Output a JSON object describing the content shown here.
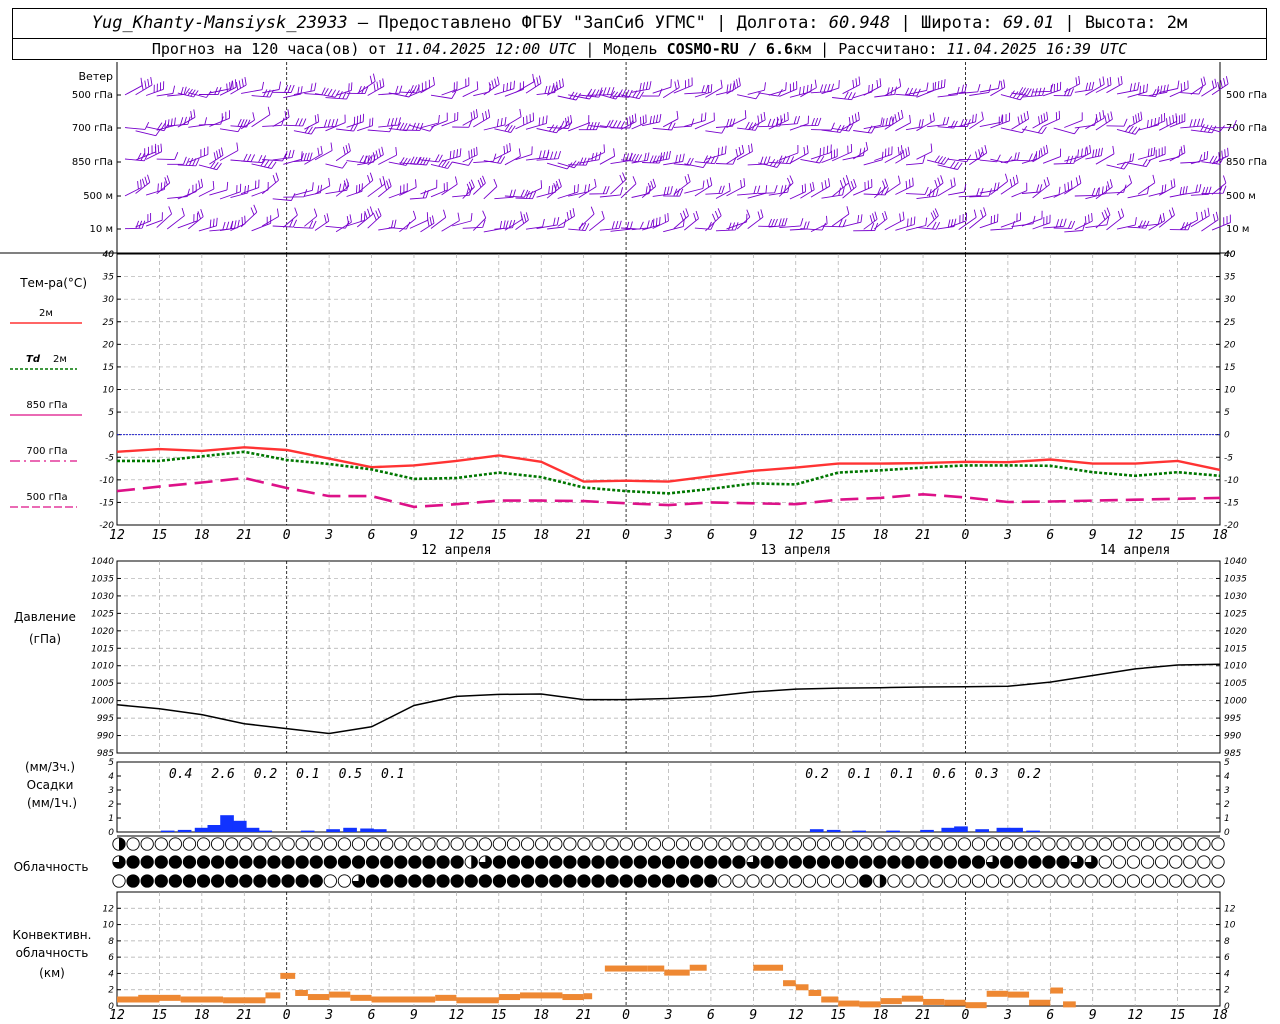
{
  "header": {
    "station": "Yug_Khanty-Mansiysk_23933",
    "provider": "— Предоставлено ФГБУ \"ЗапСиб УГМС\"",
    "lon_label": "Долгота:",
    "lon_value": "60.948",
    "lat_label": "Широта:",
    "lat_value": "69.01",
    "alt_label": "Высота:",
    "alt_value": "2м",
    "forecast_prefix": "Прогноз на 120 часа(ов) от",
    "forecast_time": "11.04.2025 12:00 UTC",
    "model_label": "Модель",
    "model_name": "COSMO-RU / 6.6",
    "model_unit": "км",
    "calc_label": "Рассчитано:",
    "calc_time": "11.04.2025 16:39 UTC",
    "sep": "|"
  },
  "labels": {
    "wind": "Ветер",
    "temp": "Тем-ра(°C)",
    "t2m": "2м",
    "td": "Td",
    "td2": "2м",
    "t850": "850 гПа",
    "t700": "700 гПа",
    "t500": "500 гПа",
    "pressure": "Давление",
    "pressure_unit": "(гПа)",
    "precip_unit3": "(мм/3ч.)",
    "precip": "Осадки",
    "precip_unit1": "(мм/1ч.)",
    "cloud": "Облачность",
    "conv1": "Конвективн.",
    "conv2": "облачность",
    "conv3": "(км)"
  },
  "colors": {
    "t2m": "#ff3333",
    "td": "#007700",
    "t850": "#dd1188",
    "t700": "#dd1188",
    "t500": "#dd1188",
    "wind": "#7700cc",
    "precip": "#1133ff",
    "conv": "#ee8833",
    "zero": "#2222cc"
  },
  "chart_data": [
    {
      "type": "wind-barbs",
      "levels": [
        "500 гПа",
        "700 гПа",
        "850 гПа",
        "500 м",
        "10 м"
      ],
      "ylim_label": "40"
    },
    {
      "type": "line",
      "x": [
        "12",
        "15",
        "18",
        "21",
        "0",
        "3",
        "6",
        "9",
        "12",
        "15",
        "18",
        "21",
        "0",
        "3",
        "6",
        "9",
        "12",
        "15",
        "18",
        "21",
        "0",
        "3",
        "6",
        "9",
        "12",
        "15",
        "18"
      ],
      "dates": [
        {
          "label": "12 апреля",
          "at": 8
        },
        {
          "label": "13 апреля",
          "at": 16
        },
        {
          "label": "14 апреля",
          "at": 24
        }
      ],
      "ylim": [
        -20,
        40
      ],
      "yticks": [
        40,
        35,
        30,
        25,
        20,
        15,
        10,
        5,
        0,
        -5,
        -10,
        -15,
        -20
      ],
      "series": [
        {
          "name": "2м",
          "key": "t2m",
          "values": [
            -3.8,
            -3.2,
            -3.6,
            -2.8,
            -3.4,
            -5.3,
            -7.2,
            -6.8,
            -5.8,
            -4.6,
            -6.0,
            -10.4,
            -10.2,
            -10.4,
            -9.2,
            -8.0,
            -7.3,
            -6.4,
            -6.4,
            -6.3,
            -6.0,
            -6.1,
            -5.5,
            -6.4,
            -6.4,
            -5.8,
            -7.8
          ]
        },
        {
          "name": "Td 2м",
          "key": "td",
          "values": [
            -5.8,
            -5.8,
            -4.8,
            -3.8,
            -5.6,
            -6.5,
            -7.7,
            -9.8,
            -9.6,
            -8.4,
            -9.4,
            -11.7,
            -12.5,
            -13.0,
            -12.0,
            -10.8,
            -11.0,
            -8.4,
            -7.9,
            -7.3,
            -6.8,
            -6.8,
            -6.9,
            -8.3,
            -9.1,
            -8.3,
            -9.1
          ]
        },
        {
          "name": "850 гПа",
          "key": "t850",
          "values": [
            -12.5,
            -11.5,
            -10.6,
            -9.6,
            -11.8,
            -13.6,
            -13.6,
            -16.0,
            -15.4,
            -14.6,
            -14.6,
            -14.7,
            -15.2,
            -15.6,
            -15.0,
            -15.2,
            -15.4,
            -14.4,
            -14.0,
            -13.2,
            -13.9,
            -14.9,
            -14.8,
            -14.6,
            -14.4,
            -14.2,
            -14.0
          ]
        }
      ]
    },
    {
      "type": "line",
      "name": "pressure",
      "ylim": [
        985,
        1040
      ],
      "yticks": [
        1040,
        1035,
        1030,
        1025,
        1020,
        1015,
        1010,
        1005,
        1000,
        995,
        990,
        985
      ],
      "values": [
        998.8,
        997.7,
        996.0,
        993.4,
        992.0,
        990.6,
        992.5,
        998.6,
        1001.2,
        1001.8,
        1001.9,
        1000.3,
        1000.3,
        1000.6,
        1001.2,
        1002.5,
        1003.3,
        1003.6,
        1003.7,
        1003.9,
        1004.0,
        1004.1,
        1005.3,
        1007.2,
        1009.1,
        1010.2,
        1010.4
      ]
    },
    {
      "type": "bar",
      "name": "precip",
      "ylim": [
        0,
        5
      ],
      "yticks": [
        5,
        4,
        3,
        2,
        1,
        0
      ],
      "sums3h": [
        {
          "at": 1.5,
          "label": "0.4"
        },
        {
          "at": 2.5,
          "label": "2.6"
        },
        {
          "at": 3.5,
          "label": "0.2"
        },
        {
          "at": 4.5,
          "label": "0.1"
        },
        {
          "at": 5.5,
          "label": "0.5"
        },
        {
          "at": 6.5,
          "label": "0.1"
        },
        {
          "at": 16.5,
          "label": "0.2"
        },
        {
          "at": 17.5,
          "label": "0.1"
        },
        {
          "at": 18.5,
          "label": "0.1"
        },
        {
          "at": 19.5,
          "label": "0.6"
        },
        {
          "at": 20.5,
          "label": "0.3"
        },
        {
          "at": 21.5,
          "label": "0.2"
        }
      ],
      "hourly": [
        [
          1.2,
          0.1
        ],
        [
          1.6,
          0.15
        ],
        [
          2.0,
          0.3
        ],
        [
          2.3,
          0.5
        ],
        [
          2.6,
          1.2
        ],
        [
          2.9,
          0.8
        ],
        [
          3.2,
          0.3
        ],
        [
          3.5,
          0.1
        ],
        [
          4.5,
          0.1
        ],
        [
          5.1,
          0.2
        ],
        [
          5.5,
          0.3
        ],
        [
          5.9,
          0.25
        ],
        [
          6.2,
          0.2
        ],
        [
          16.5,
          0.2
        ],
        [
          16.9,
          0.15
        ],
        [
          17.5,
          0.1
        ],
        [
          18.3,
          0.1
        ],
        [
          19.1,
          0.15
        ],
        [
          19.6,
          0.3
        ],
        [
          19.9,
          0.4
        ],
        [
          20.4,
          0.2
        ],
        [
          20.9,
          0.3
        ],
        [
          21.2,
          0.3
        ],
        [
          21.6,
          0.1
        ]
      ]
    },
    {
      "type": "table",
      "name": "cloud",
      "rows": [
        "upper",
        "middle",
        "lower"
      ],
      "cover": [
        "2000000000000000000000000000000000000000000000000000000000000000000000000000000000000000000000000000000000000000000000000000000000000000000000000000000000000000000000000000000000000000000000000",
        "3444444444444444444444444234444444444444444443444444444444444434444433000000000000000000000000004444444434432444432100000000000000000000000000000000000000000000000000000000000000000000000",
        "0444444444444440034444444444444444444444444000000000042000000000000000000000000000000000000000000000044444444444444444444444444444000000000000000000000000000000000000000000000000000000000"
      ]
    },
    {
      "type": "bar",
      "name": "convective",
      "ylim": [
        0,
        14
      ],
      "yticks": [
        12,
        10,
        8,
        6,
        4,
        2,
        0
      ],
      "segments": [
        [
          0.0,
          1.0,
          0.8
        ],
        [
          0.5,
          1.5,
          1.0
        ],
        [
          1.5,
          2.5,
          0.8
        ],
        [
          2.5,
          3.5,
          0.7
        ],
        [
          3.5,
          3.85,
          1.3
        ],
        [
          3.85,
          4.2,
          3.7
        ],
        [
          4.2,
          4.5,
          1.6
        ],
        [
          4.5,
          5.0,
          1.1
        ],
        [
          5.0,
          5.5,
          1.4
        ],
        [
          5.5,
          6.0,
          1.0
        ],
        [
          6.0,
          7.5,
          0.8
        ],
        [
          7.5,
          8.0,
          1.0
        ],
        [
          8.0,
          9.0,
          0.7
        ],
        [
          9.0,
          9.5,
          1.1
        ],
        [
          9.5,
          10.5,
          1.3
        ],
        [
          10.5,
          11.0,
          1.1
        ],
        [
          11.0,
          11.2,
          1.2
        ],
        [
          11.5,
          12.5,
          4.6
        ],
        [
          12.5,
          12.9,
          4.6
        ],
        [
          12.9,
          13.5,
          4.1
        ],
        [
          13.5,
          13.9,
          4.7
        ],
        [
          15.0,
          15.7,
          4.7
        ],
        [
          15.7,
          16.0,
          2.8
        ],
        [
          16.0,
          16.3,
          2.3
        ],
        [
          16.3,
          16.6,
          1.6
        ],
        [
          16.6,
          17.0,
          0.8
        ],
        [
          17.0,
          17.5,
          0.3
        ],
        [
          17.5,
          18.0,
          0.2
        ],
        [
          18.0,
          18.5,
          0.6
        ],
        [
          18.5,
          19.0,
          0.9
        ],
        [
          19.0,
          19.5,
          0.5
        ],
        [
          19.5,
          20.0,
          0.4
        ],
        [
          20.0,
          20.5,
          0.1
        ],
        [
          20.5,
          21.0,
          1.5
        ],
        [
          21.0,
          21.5,
          1.4
        ],
        [
          21.5,
          22.0,
          0.4
        ],
        [
          22.0,
          22.3,
          1.9
        ],
        [
          22.3,
          22.6,
          0.2
        ]
      ]
    }
  ]
}
